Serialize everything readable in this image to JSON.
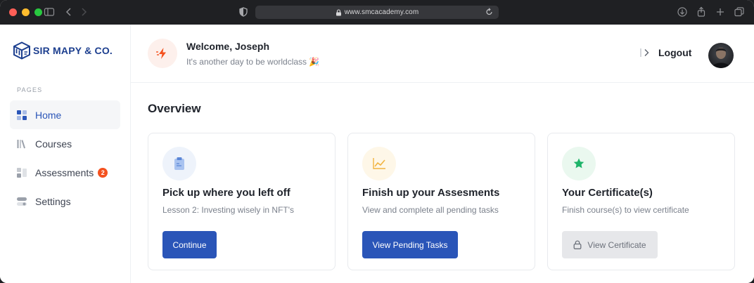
{
  "browser": {
    "url": "www.smcacademy.com"
  },
  "sidebar": {
    "logo_text": "SIR MAPY & CO.",
    "section_label": "PAGES",
    "items": [
      {
        "label": "Home",
        "icon": "grid-icon",
        "active": true
      },
      {
        "label": "Courses",
        "icon": "books-icon"
      },
      {
        "label": "Assessments",
        "icon": "assessment-icon",
        "badge": "2"
      },
      {
        "label": "Settings",
        "icon": "toggle-icon"
      }
    ]
  },
  "header": {
    "welcome_title": "Welcome, Joseph",
    "welcome_subtitle": "It's another day to be worldclass 🎉",
    "logout_label": "Logout"
  },
  "main": {
    "section_title": "Overview",
    "cards": [
      {
        "title": "Pick up where you left off",
        "description": "Lesson 2: Investing wisely in NFT's",
        "button": "Continue",
        "icon": "clipboard-icon"
      },
      {
        "title": "Finish up your Assesments",
        "description": "View and complete all pending tasks",
        "button": "View Pending Tasks",
        "icon": "chart-line-icon"
      },
      {
        "title": "Your Certificate(s)",
        "description": "Finish course(s) to view certificate",
        "button": "View Certificate",
        "icon": "star-icon"
      }
    ]
  },
  "colors": {
    "primary": "#2a55b8",
    "badge": "#f4511e",
    "accent_orange": "#f4511e"
  }
}
